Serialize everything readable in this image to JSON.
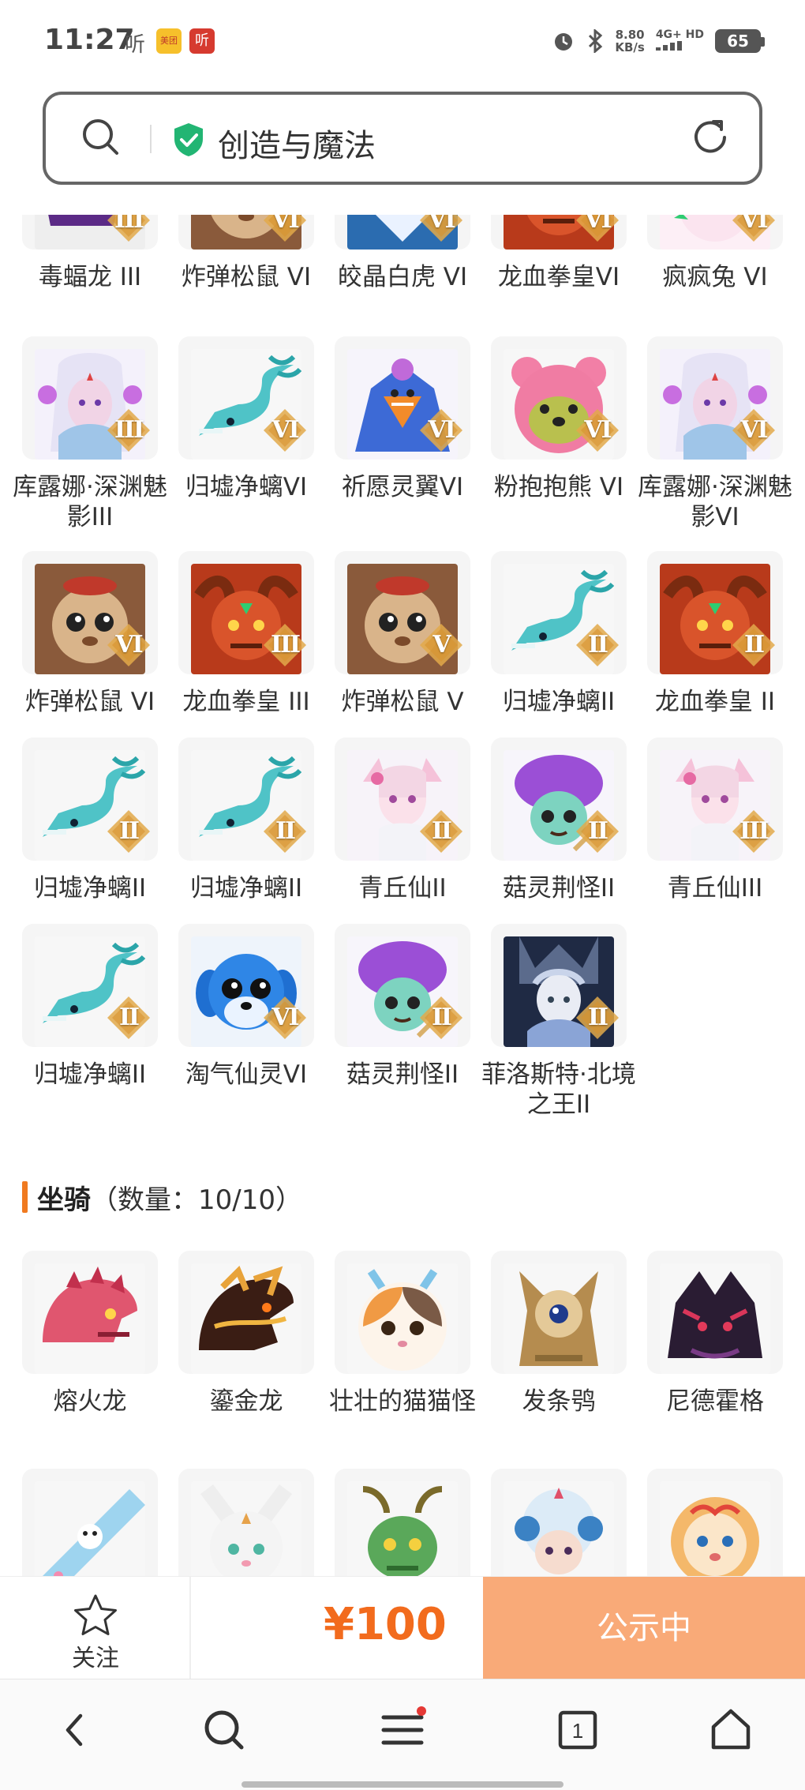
{
  "status_bar": {
    "time": "11:27",
    "app1": "听",
    "app2_badge": "美团",
    "app3_badge": "听",
    "netspeed_value": "8.80",
    "netspeed_unit": "KB/s",
    "network": "4G+ HD",
    "battery": "65"
  },
  "search": {
    "query": "创造与魔法"
  },
  "pets": {
    "rows": [
      [
        {
          "name": "毒蝠龙 III",
          "grade": "III",
          "icon": "bat-dragon"
        },
        {
          "name": "炸弹松鼠 VI",
          "grade": "VI",
          "icon": "squirrel"
        },
        {
          "name": "皎晶白虎 VI",
          "grade": "VI",
          "icon": "white-tiger"
        },
        {
          "name": "龙血拳皇VI",
          "grade": "VI",
          "icon": "fire-beast"
        },
        {
          "name": "疯疯兔 VI",
          "grade": "VI",
          "icon": "rabbit"
        }
      ],
      [
        {
          "name": "库露娜·深渊魅影III",
          "grade": "III",
          "icon": "kuluna"
        },
        {
          "name": "归墟净螭VI",
          "grade": "VI",
          "icon": "jade-dragon"
        },
        {
          "name": "祈愿灵翼VI",
          "grade": "VI",
          "icon": "phoenix"
        },
        {
          "name": "粉抱抱熊 VI",
          "grade": "VI",
          "icon": "pink-bear"
        },
        {
          "name": "库露娜·深渊魅影VI",
          "grade": "VI",
          "icon": "kuluna"
        }
      ],
      [
        {
          "name": "炸弹松鼠 VI",
          "grade": "VI",
          "icon": "squirrel"
        },
        {
          "name": "龙血拳皇 III",
          "grade": "III",
          "icon": "fire-beast"
        },
        {
          "name": "炸弹松鼠 V",
          "grade": "V",
          "icon": "squirrel"
        },
        {
          "name": "归墟净螭II",
          "grade": "II",
          "icon": "jade-dragon"
        },
        {
          "name": "龙血拳皇 II",
          "grade": "II",
          "icon": "fire-beast"
        }
      ],
      [
        {
          "name": "归墟净螭II",
          "grade": "II",
          "icon": "jade-dragon"
        },
        {
          "name": "归墟净螭II",
          "grade": "II",
          "icon": "jade-dragon"
        },
        {
          "name": "青丘仙II",
          "grade": "II",
          "icon": "fox-fairy"
        },
        {
          "name": "菇灵荆怪II",
          "grade": "II",
          "icon": "mushroom-elf"
        },
        {
          "name": "青丘仙III",
          "grade": "III",
          "icon": "fox-fairy"
        }
      ],
      [
        {
          "name": "归墟净螭II",
          "grade": "II",
          "icon": "jade-dragon"
        },
        {
          "name": "淘气仙灵VI",
          "grade": "VI",
          "icon": "blue-pup"
        },
        {
          "name": "菇灵荆怪II",
          "grade": "II",
          "icon": "mushroom-elf"
        },
        {
          "name": "菲洛斯特·北境之王II",
          "grade": "II",
          "icon": "frost-king"
        }
      ]
    ]
  },
  "mounts": {
    "section_label": "坐骑",
    "count_label": "（数量：10/10）",
    "rows": [
      [
        {
          "name": "熔火龙",
          "icon": "lava-dragon"
        },
        {
          "name": "鎏金龙",
          "icon": "gold-dragon"
        },
        {
          "name": "壮壮的猫猫怪",
          "icon": "cat-monster"
        },
        {
          "name": "发条鸮",
          "icon": "clockwork-owl"
        },
        {
          "name": "尼德霍格",
          "icon": "nidhogg"
        }
      ],
      [
        {
          "name": "",
          "icon": "skateboard"
        },
        {
          "name": "",
          "icon": "white-fox"
        },
        {
          "name": "",
          "icon": "green-dragon"
        },
        {
          "name": "",
          "icon": "sheep-girl"
        },
        {
          "name": "",
          "icon": "lion-cub"
        }
      ]
    ]
  },
  "purchase": {
    "follow_label": "关注",
    "price": "¥100",
    "status_label": "公示中"
  },
  "colors": {
    "accent": "#f26b1d",
    "button": "#f9aa78",
    "shield": "#22b573",
    "grade_badge": "#e2a94a"
  }
}
